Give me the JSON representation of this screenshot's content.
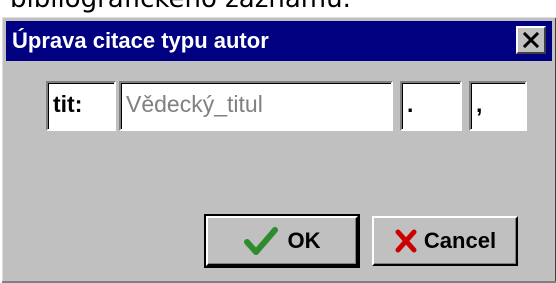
{
  "background_text": "bibliografického záznamu.",
  "window": {
    "title": "Úprava citace typu autor"
  },
  "fields": {
    "prefix": "tit:",
    "main_value": "Vědecký_titul",
    "separator_1": ".",
    "separator_2": ","
  },
  "buttons": {
    "ok": "OK",
    "cancel": "Cancel"
  },
  "icons": {
    "close": "close-icon",
    "ok": "checkmark-icon",
    "cancel": "x-icon"
  },
  "colors": {
    "titlebar": "#000080",
    "face": "#c0c0c0",
    "check": "#2e8b2e",
    "cross": "#cc0000"
  }
}
